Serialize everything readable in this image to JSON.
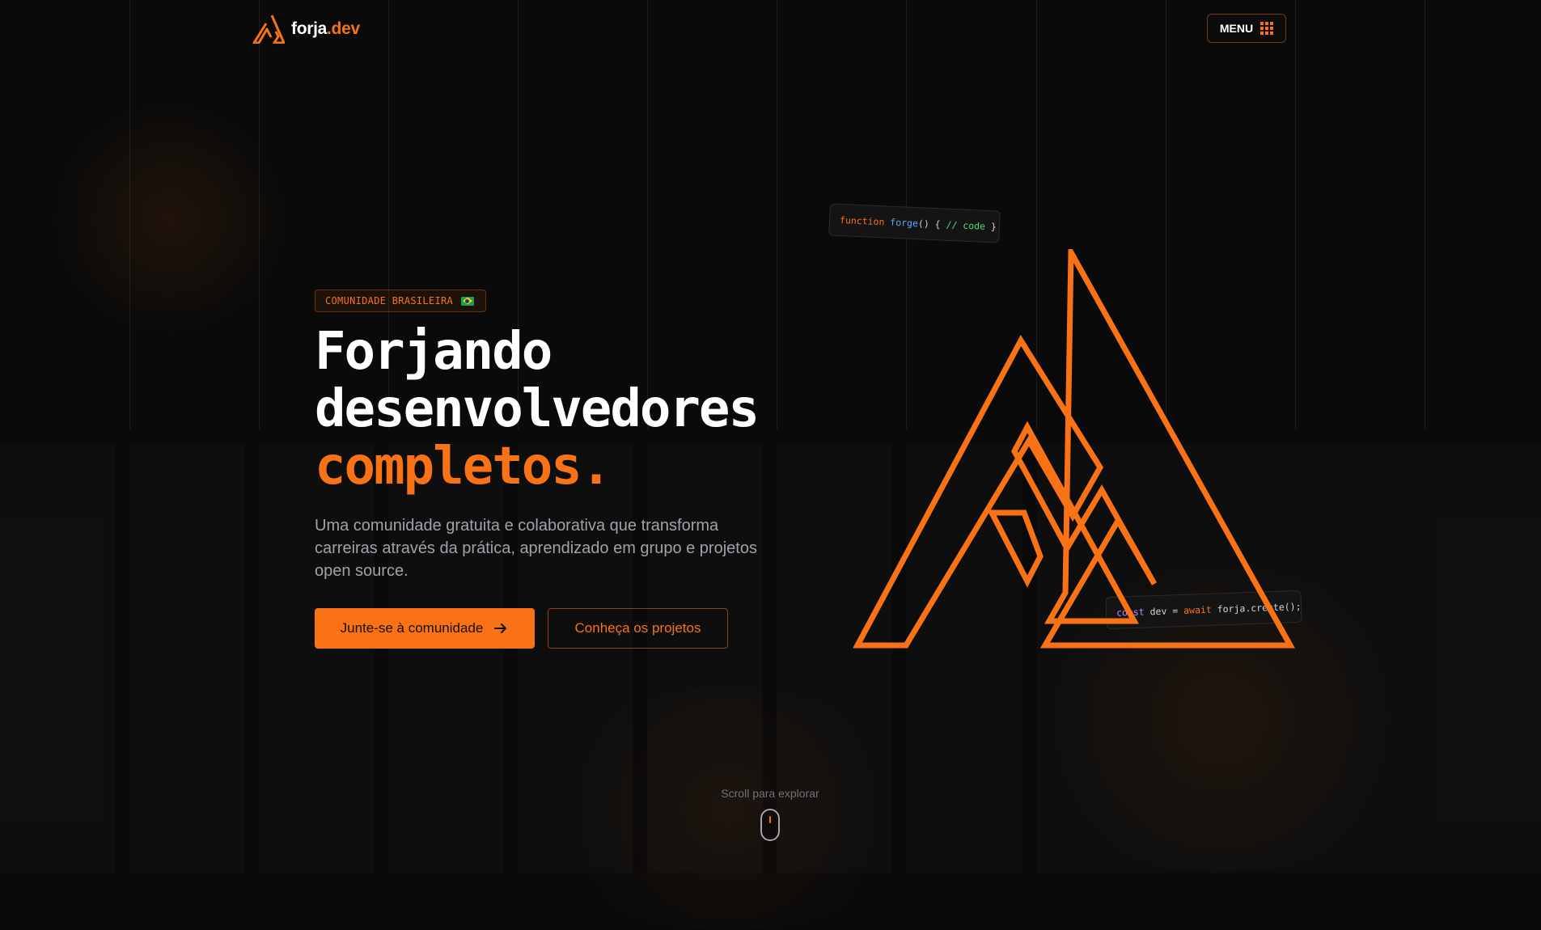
{
  "header": {
    "brand": {
      "name": "forja",
      "suffix": ".dev"
    },
    "menu_label": "MENU"
  },
  "hero": {
    "badge": {
      "text": "COMUNIDADE BRASILEIRA",
      "flag_icon": "brazil-flag-icon"
    },
    "headline": {
      "line1": "Forjando",
      "line2": "desenvolvedores",
      "line3": "completos."
    },
    "subtitle": "Uma comunidade gratuita e colaborativa que transforma carreiras através da prática, aprendizado em grupo e projetos open source.",
    "primary_cta": {
      "label": "Junte-se à comunidade",
      "icon": "arrow-right-icon"
    },
    "secondary_cta": {
      "label": "Conheça os projetos"
    }
  },
  "code_snippets": {
    "top": {
      "keyword": "function",
      "name": "forge",
      "parens": "()",
      "open": "{",
      "comment": "// code",
      "close": "}"
    },
    "bottom": {
      "keyword": "const",
      "variable": "dev",
      "equals": "=",
      "await": "await",
      "call": "forja.create();"
    }
  },
  "scroll": {
    "label": "Scroll para explorar",
    "icon": "mouse-icon"
  },
  "colors": {
    "accent": "#f97316",
    "background": "#0a0a0a",
    "muted_text": "#a1a1aa"
  }
}
